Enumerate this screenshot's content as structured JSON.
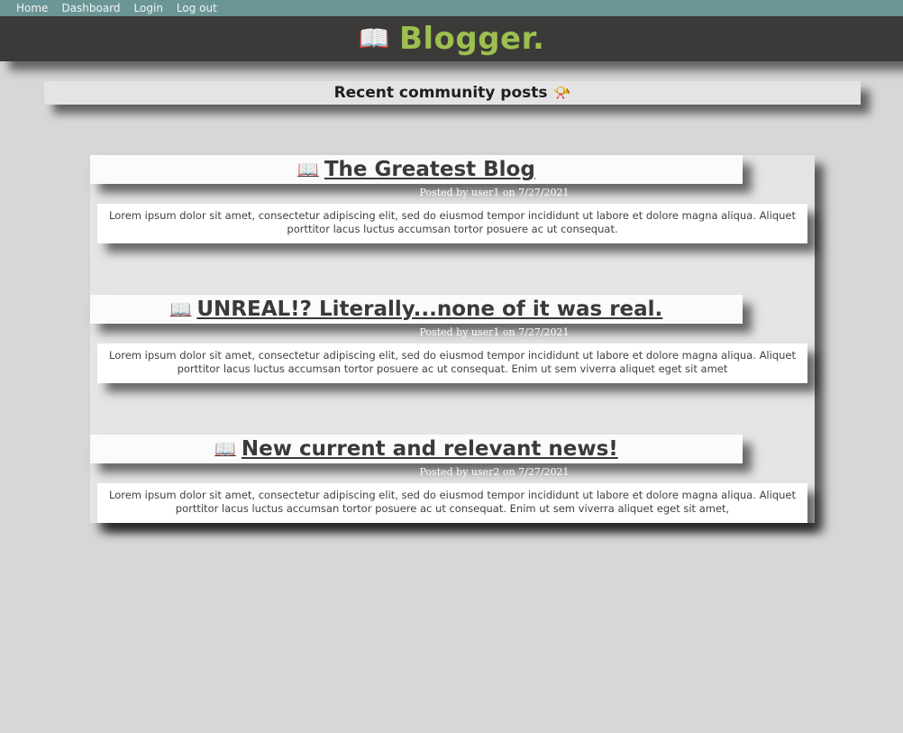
{
  "nav": {
    "items": [
      {
        "label": "Home"
      },
      {
        "label": "Dashboard"
      },
      {
        "label": "Login"
      },
      {
        "label": "Log out"
      }
    ]
  },
  "brand": {
    "icon": "📖",
    "name": "Blogger."
  },
  "recent": {
    "title": "Recent community posts",
    "icon": "📯"
  },
  "posts": [
    {
      "icon": "📖",
      "title": "The Greatest Blog",
      "meta": "Posted by user1 on 7/27/2021",
      "body": "Lorem ipsum dolor sit amet, consectetur adipiscing elit, sed do eiusmod tempor incididunt ut labore et dolore magna aliqua. Aliquet porttitor lacus luctus accumsan tortor posuere ac ut consequat."
    },
    {
      "icon": "📖",
      "title": "UNREAL!? Literally...none of it was real.",
      "meta": "Posted by user1 on 7/27/2021",
      "body": "Lorem ipsum dolor sit amet, consectetur adipiscing elit, sed do eiusmod tempor incididunt ut labore et dolore magna aliqua. Aliquet porttitor lacus luctus accumsan tortor posuere ac ut consequat. Enim ut sem viverra aliquet eget sit amet"
    },
    {
      "icon": "📖",
      "title": "New current and relevant news!",
      "meta": "Posted by user2 on 7/27/2021",
      "body": "Lorem ipsum dolor sit amet, consectetur adipiscing elit, sed do eiusmod tempor incididunt ut labore et dolore magna aliqua. Aliquet porttitor lacus luctus accumsan tortor posuere ac ut consequat. Enim ut sem viverra aliquet eget sit amet,"
    }
  ],
  "colors": {
    "nav_bg": "#6b9696",
    "brand_bg": "#3b3a38",
    "brand_text": "#9dbf4f",
    "page_bg": "#d6d8d6"
  }
}
